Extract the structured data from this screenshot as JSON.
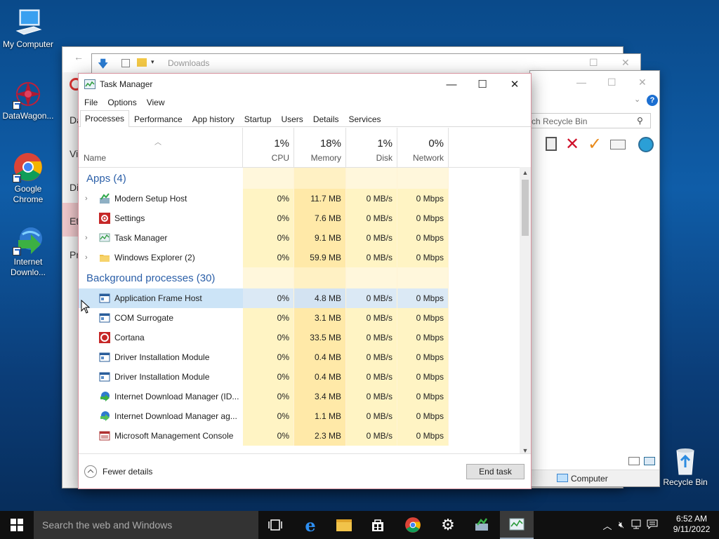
{
  "desktop": {
    "icons": [
      {
        "label": "My Computer"
      },
      {
        "label": "DataWagon..."
      },
      {
        "label": "Google\nChrome"
      },
      {
        "label": "Internet\nDownlo..."
      },
      {
        "label": "Recycle Bin"
      }
    ]
  },
  "bg_windows": {
    "downloads_window": {
      "address": "Downloads"
    },
    "recycle_window": {
      "search_placeholder": "ch Recycle Bin",
      "side_letters": [
        "Da",
        "Vi",
        "Di",
        "Et",
        "Pr"
      ],
      "status_item": "Computer"
    }
  },
  "task_manager": {
    "title": "Task Manager",
    "menu": [
      "File",
      "Options",
      "View"
    ],
    "tabs": [
      "Processes",
      "Performance",
      "App history",
      "Startup",
      "Users",
      "Details",
      "Services"
    ],
    "active_tab": "Processes",
    "columns": {
      "name": "Name",
      "cpu": {
        "pct": "1%",
        "label": "CPU"
      },
      "memory": {
        "pct": "18%",
        "label": "Memory"
      },
      "disk": {
        "pct": "1%",
        "label": "Disk"
      },
      "network": {
        "pct": "0%",
        "label": "Network"
      }
    },
    "groups": [
      {
        "title": "Apps (4)",
        "rows": [
          {
            "name": "Modern Setup Host",
            "cpu": "0%",
            "mem": "11.7 MB",
            "disk": "0 MB/s",
            "net": "0 Mbps",
            "expand": true,
            "icon": "setup-icon"
          },
          {
            "name": "Settings",
            "cpu": "0%",
            "mem": "7.6 MB",
            "disk": "0 MB/s",
            "net": "0 Mbps",
            "expand": false,
            "icon": "gear-icon"
          },
          {
            "name": "Task Manager",
            "cpu": "0%",
            "mem": "9.1 MB",
            "disk": "0 MB/s",
            "net": "0 Mbps",
            "expand": true,
            "icon": "taskmgr-icon"
          },
          {
            "name": "Windows Explorer (2)",
            "cpu": "0%",
            "mem": "59.9 MB",
            "disk": "0 MB/s",
            "net": "0 Mbps",
            "expand": true,
            "icon": "folder-icon"
          }
        ]
      },
      {
        "title": "Background processes (30)",
        "rows": [
          {
            "name": "Application Frame Host",
            "cpu": "0%",
            "mem": "4.8 MB",
            "disk": "0 MB/s",
            "net": "0 Mbps",
            "expand": false,
            "icon": "app-window-icon",
            "selected": true
          },
          {
            "name": "COM Surrogate",
            "cpu": "0%",
            "mem": "3.1 MB",
            "disk": "0 MB/s",
            "net": "0 Mbps",
            "expand": false,
            "icon": "app-window-icon"
          },
          {
            "name": "Cortana",
            "cpu": "0%",
            "mem": "33.5 MB",
            "disk": "0 MB/s",
            "net": "0 Mbps",
            "expand": false,
            "icon": "cortana-icon"
          },
          {
            "name": "Driver Installation Module",
            "cpu": "0%",
            "mem": "0.4 MB",
            "disk": "0 MB/s",
            "net": "0 Mbps",
            "expand": false,
            "icon": "app-window-icon"
          },
          {
            "name": "Driver Installation Module",
            "cpu": "0%",
            "mem": "0.4 MB",
            "disk": "0 MB/s",
            "net": "0 Mbps",
            "expand": false,
            "icon": "app-window-icon"
          },
          {
            "name": "Internet Download Manager (ID...",
            "cpu": "0%",
            "mem": "3.4 MB",
            "disk": "0 MB/s",
            "net": "0 Mbps",
            "expand": false,
            "icon": "idm-icon"
          },
          {
            "name": "Internet Download Manager ag...",
            "cpu": "0%",
            "mem": "1.1 MB",
            "disk": "0 MB/s",
            "net": "0 Mbps",
            "expand": false,
            "icon": "idm-agent-icon"
          },
          {
            "name": "Microsoft Management Console",
            "cpu": "0%",
            "mem": "2.3 MB",
            "disk": "0 MB/s",
            "net": "0 Mbps",
            "expand": false,
            "icon": "mmc-icon"
          }
        ]
      }
    ],
    "footer": {
      "fewer_details": "Fewer details",
      "end_task": "End task"
    }
  },
  "taskbar": {
    "search_placeholder": "Search the web and Windows",
    "time": "6:52 AM",
    "date": "9/11/2022"
  }
}
